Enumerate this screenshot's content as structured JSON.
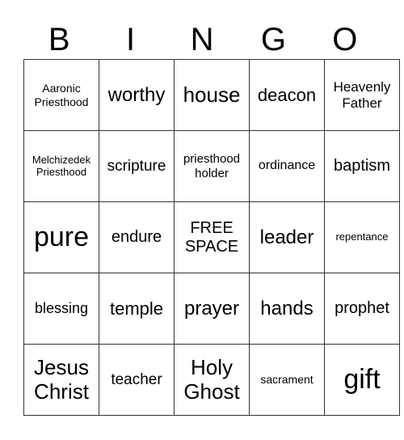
{
  "header": [
    "B",
    "I",
    "N",
    "G",
    "O"
  ],
  "rows": [
    [
      "Aaronic Priesthood",
      "worthy",
      "house",
      "deacon",
      "Heavenly Father"
    ],
    [
      "Melchizedek Priesthood",
      "scripture",
      "priesthood holder",
      "ordinance",
      "baptism"
    ],
    [
      "pure",
      "endure",
      "FREE SPACE",
      "leader",
      "repentance"
    ],
    [
      "blessing",
      "temple",
      "prayer",
      "hands",
      "prophet"
    ],
    [
      "Jesus Christ",
      "teacher",
      "Holy Ghost",
      "sacrament",
      "gift"
    ]
  ]
}
